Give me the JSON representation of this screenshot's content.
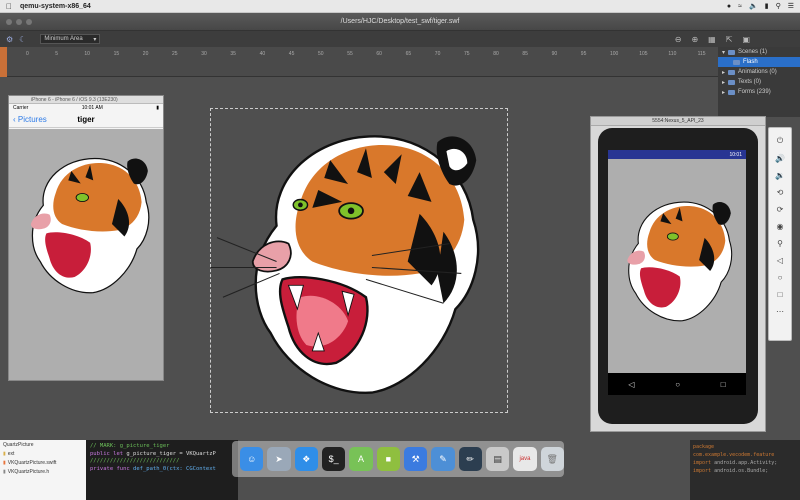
{
  "menubar": {
    "app_name": "qemu-system-x86_64"
  },
  "window": {
    "title": "/Users/HJC/Desktop/test_swf/tiger.swf"
  },
  "toolbar": {
    "area_select": "Minimum Area"
  },
  "ruler": {
    "ticks": [
      "0",
      "5",
      "10",
      "15",
      "20",
      "25",
      "30",
      "35",
      "40",
      "45",
      "50",
      "55",
      "60",
      "65",
      "70",
      "75",
      "80",
      "85",
      "90",
      "95",
      "100",
      "105",
      "110",
      "115",
      "120"
    ]
  },
  "scenes_panel": {
    "items": [
      {
        "label": "Scenes (1)"
      },
      {
        "label": "Flash"
      },
      {
        "label": "Animations (0)"
      },
      {
        "label": "Texts (0)"
      },
      {
        "label": "Forms (239)"
      }
    ]
  },
  "iphone": {
    "window_title": "iPhone 6 - iPhone 6 / iOS 9.3 (13E230)",
    "carrier": "Carrier",
    "time": "10:01 AM",
    "back_label": "Pictures",
    "nav_title": "tiger"
  },
  "android": {
    "window_title": "5554:Nexus_5_API_23",
    "time": "10:01"
  },
  "filelist": {
    "items": [
      {
        "label": "QuartzPicture"
      },
      {
        "label": "ext"
      },
      {
        "label": "VKQuartzPicture.swift"
      },
      {
        "label": "VKQuartzPicture.h"
      }
    ]
  },
  "code": {
    "line1": "// MARK: g_picture_tiger",
    "line2_kw": "public let",
    "line2_rest": " g_picture_tiger = VKQuartzP",
    "line3": "///////////////////////////",
    "line4_kw": "private func",
    "line4_rest": " def_path_0(ctx: CGContext"
  },
  "code2": {
    "line1": "package com.example.vecodem.feature",
    "line2_kw": "import",
    "line2_rest": " android.app.Activity;",
    "line3_kw": "import",
    "line3_rest": " android.os.Bundle;"
  },
  "colors": {
    "accent": "#2a6fc9",
    "tiger_orange": "#d9782b",
    "android_status": "#283593"
  }
}
